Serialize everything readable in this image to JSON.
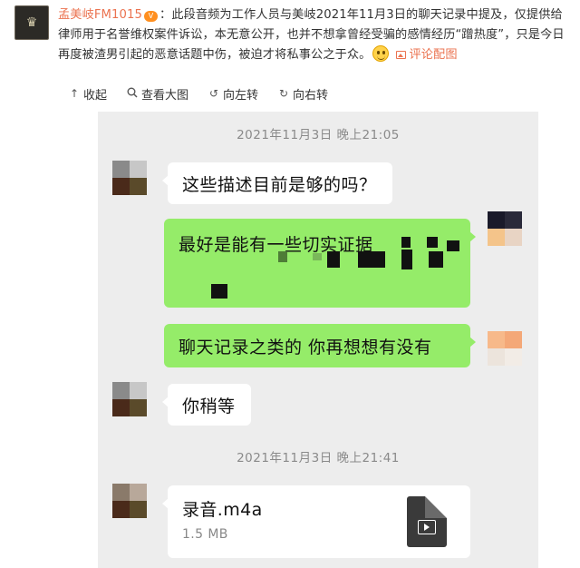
{
  "post": {
    "username": "孟美岐FM1015",
    "vip_badge": "V",
    "body": "：此段音频为工作人员与美岐2021年11月3日的聊天记录中提及，仅提供给律师用于名誉维权案件诉讼，本无意公开，也并不想拿曾经受骗的感情经历“蹭热度”，只是今日再度被渣男引起的恶意话题中伤，被迫才将私事公之于众。",
    "comment_link": "评论配图"
  },
  "toolbar": {
    "collapse": "收起",
    "view_large": "查看大图",
    "rotate_left": "向左转",
    "rotate_right": "向右转"
  },
  "chat": {
    "timestamp_1": "2021年11月3日 晚上21:05",
    "msg_1": "这些描述目前是够的吗？",
    "msg_2": "最好是能有一些切实证据",
    "msg_3": "聊天记录之类的 你再想想有没有",
    "msg_4": "你稍等",
    "timestamp_2": "2021年11月3日 晚上21:41",
    "file_name": "录音.m4a",
    "file_size": "1.5 MB"
  },
  "icons": {
    "collapse": "arrow-up-icon",
    "view_large": "search-icon",
    "rotate_left": "rotate-left-icon",
    "rotate_right": "rotate-right-icon",
    "file": "video-file-icon"
  },
  "colors": {
    "username": "#eb7350",
    "bubble_out": "#95ec69",
    "bubble_in": "#ffffff",
    "chat_bg": "#ededed"
  }
}
